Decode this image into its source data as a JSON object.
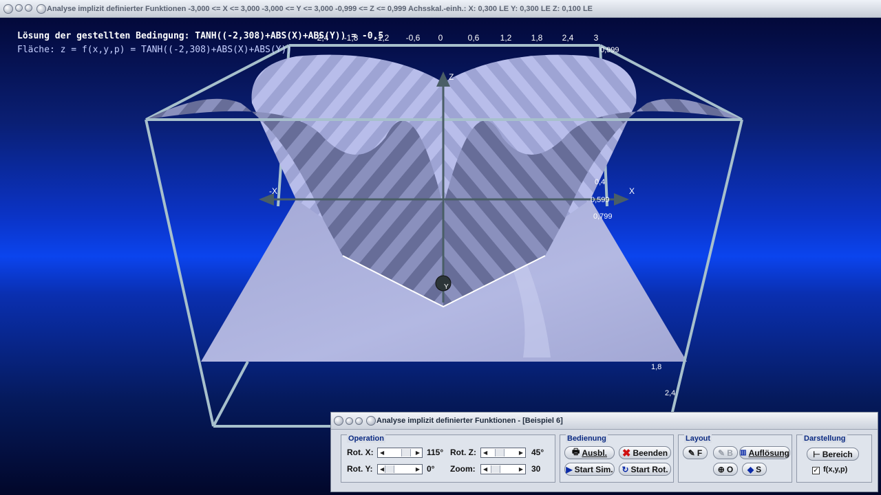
{
  "window": {
    "title": "Analyse implizit definierter Funktionen   -3,000 <= X <= 3,000  -3,000 <= Y <= 3,000  -0,999 <= Z <= 0,999  Achsskal.-einh.:  X: 0,300 LE    Y: 0,300 LE    Z: 0,100 LE"
  },
  "overlay": {
    "line1": "Lösung der gestellten Bedingung: TANH((-2,308)+ABS(X)+ABS(Y)) = -0,5",
    "line2": "Fläche: z = f(x,y,p) = TANH((-2,308)+ABS(X)+ABS(Y))"
  },
  "scene": {
    "top_ticks": [
      "-2,4",
      "-1,8",
      "-1,2",
      "-0,6",
      "0",
      "0,6",
      "1,2",
      "1,8",
      "2,4",
      "3"
    ],
    "z_top_label": "0,999",
    "side_ticks": [
      "0,4",
      "0,599",
      "0,799",
      "1,8",
      "2,4"
    ],
    "axis_labels": {
      "z": "Z",
      "x": "X",
      "neg_x": "-X",
      "y": "Y"
    },
    "colors": {
      "surface_top": "#b0b6e0",
      "surface_stripe": "#7c82a8",
      "plane": "#a9add8",
      "box": "#9fb8c4",
      "bg_band": "#0a3bd6"
    }
  },
  "dialog": {
    "title": "Analyse implizit definierter Funktionen - [Beispiel 6]",
    "operation": {
      "label": "Operation",
      "rot_x_label": "Rot. X:",
      "rot_x_value": "115°",
      "rot_y_label": "Rot. Y:",
      "rot_y_value": "0°",
      "rot_z_label": "Rot. Z:",
      "rot_z_value": "45°",
      "zoom_label": "Zoom:",
      "zoom_value": "30"
    },
    "bedienung": {
      "label": "Bedienung",
      "ausbl": "Ausbl.",
      "beenden": "Beenden",
      "start_sim": "Start Sim.",
      "start_rot": "Start Rot."
    },
    "layout": {
      "label": "Layout",
      "f": "F",
      "b": "B",
      "aufloesung": "Auflösung",
      "o": "O",
      "s": "S"
    },
    "darstellung": {
      "label": "Darstellung",
      "bereich": "Bereich",
      "fxyp": "f(x,y,p)",
      "fxyp_checked": true
    }
  }
}
